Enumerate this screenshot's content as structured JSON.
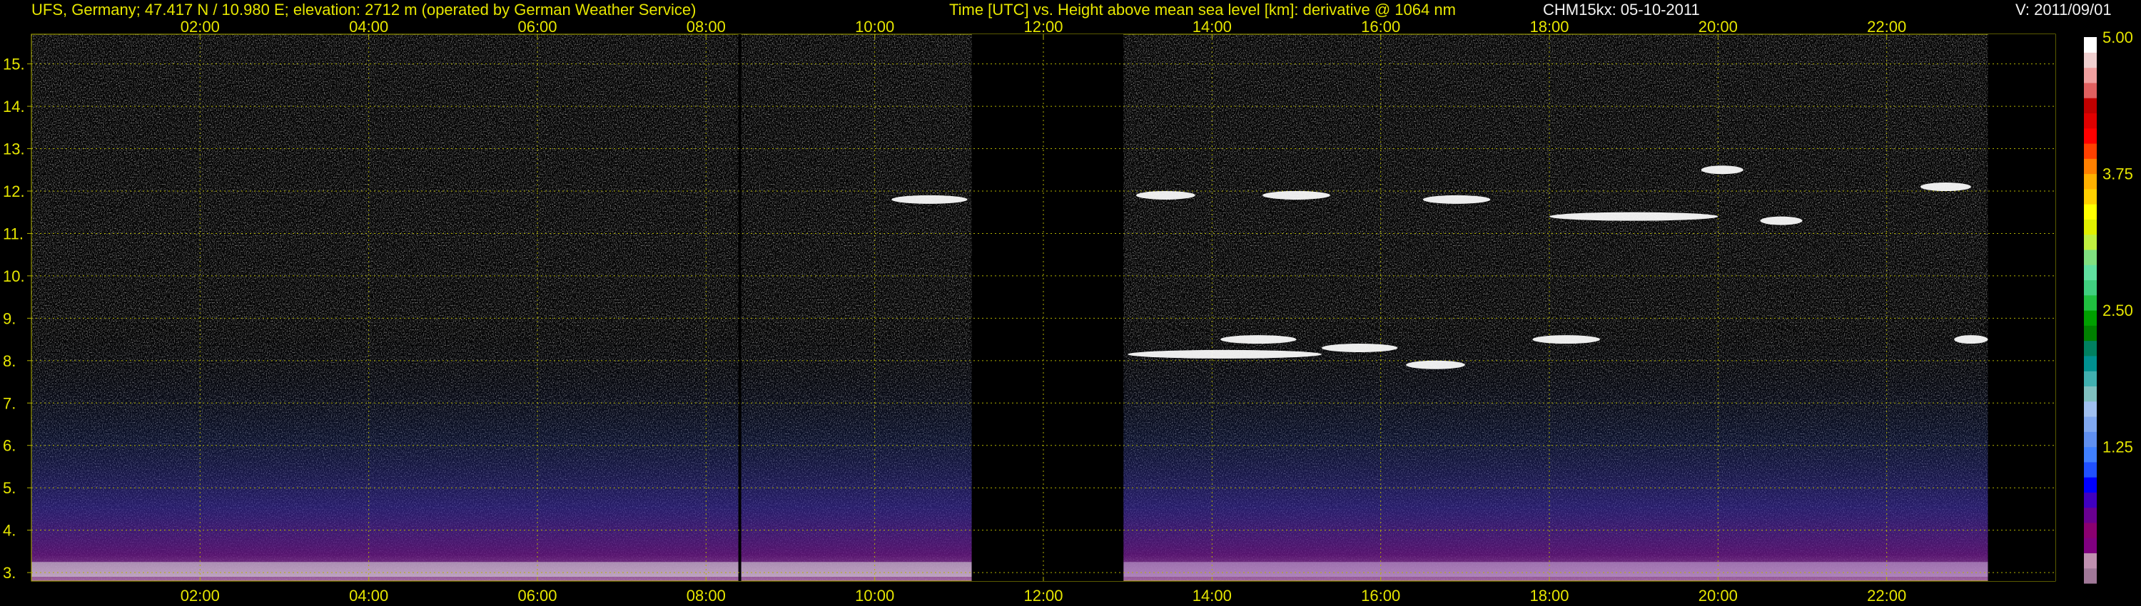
{
  "header": {
    "station": "UFS, Germany; 47.417 N / 10.980 E; elevation: 2712 m  (operated by German Weather Service)",
    "axes_desc": "Time [UTC] vs. Height above mean sea level [km]: derivative @ 1064 nm",
    "instrument": "CHM15kx: 05-10-2011",
    "version": "V: 2011/09/01"
  },
  "colors": {
    "text": "#e6e600",
    "grid": "#b3b300",
    "background": "#000000",
    "header_white": "#f2f2f2"
  },
  "chart_data": {
    "type": "heatmap",
    "title": "Time [UTC] vs. Height above mean sea level [km]: derivative @ 1064 nm",
    "xlabel": "Time [UTC]",
    "ylabel": "Height above mean sea level [km]",
    "x_range_hours": [
      0,
      24
    ],
    "y_range_km": [
      2.8,
      15.7
    ],
    "x_ticks": [
      "02:00",
      "04:00",
      "06:00",
      "08:00",
      "10:00",
      "12:00",
      "14:00",
      "16:00",
      "18:00",
      "20:00",
      "22:00"
    ],
    "x_tick_hours": [
      2,
      4,
      6,
      8,
      10,
      12,
      14,
      16,
      18,
      20,
      22
    ],
    "y_ticks": [
      "3.",
      "4.",
      "5.",
      "6.",
      "7.",
      "8.",
      "9.",
      "10.",
      "11.",
      "12.",
      "13.",
      "14.",
      "15."
    ],
    "y_tick_values": [
      3,
      4,
      5,
      6,
      7,
      8,
      9,
      10,
      11,
      12,
      13,
      14,
      15
    ],
    "grid": true,
    "colorbar": {
      "min": 0,
      "max": 5,
      "tick_labels": [
        "5.00",
        "3.75",
        "2.50",
        "1.25"
      ],
      "tick_values": [
        5.0,
        3.75,
        2.5,
        1.25
      ],
      "palette": [
        "#a07898",
        "#c090b0",
        "#800080",
        "#8a0070",
        "#6a0090",
        "#4000c0",
        "#0000ff",
        "#2050ff",
        "#4080ff",
        "#6090f0",
        "#80a8f0",
        "#a0c0f0",
        "#80c0c0",
        "#40b0b0",
        "#009090",
        "#008060",
        "#008000",
        "#00a000",
        "#20c040",
        "#40d080",
        "#60e0a0",
        "#80e080",
        "#c0f040",
        "#e0f000",
        "#ffff00",
        "#ffd000",
        "#ffb000",
        "#ff8000",
        "#ff4000",
        "#ff0000",
        "#e00000",
        "#c00000",
        "#e06060",
        "#f0a0a0",
        "#f0d0d0",
        "#ffffff"
      ],
      "position": "right"
    },
    "data_gaps_hours": [
      [
        11.15,
        12.95
      ],
      [
        23.2,
        24.0
      ]
    ],
    "instrument_gap_line_hour": 8.4,
    "cloud_layers": [
      {
        "start_hour": 13.0,
        "end_hour": 15.3,
        "height_km": 8.15
      },
      {
        "start_hour": 14.1,
        "end_hour": 15.0,
        "height_km": 8.5
      },
      {
        "start_hour": 15.3,
        "end_hour": 16.2,
        "height_km": 8.3
      },
      {
        "start_hour": 16.3,
        "end_hour": 17.0,
        "height_km": 7.9
      },
      {
        "start_hour": 17.8,
        "end_hour": 18.6,
        "height_km": 8.5
      },
      {
        "start_hour": 22.8,
        "end_hour": 23.2,
        "height_km": 8.5
      },
      {
        "start_hour": 22.4,
        "end_hour": 23.0,
        "height_km": 12.1
      },
      {
        "start_hour": 19.8,
        "end_hour": 20.3,
        "height_km": 12.5
      },
      {
        "start_hour": 18.0,
        "end_hour": 20.0,
        "height_km": 11.4
      },
      {
        "start_hour": 20.5,
        "end_hour": 21.0,
        "height_km": 11.3
      },
      {
        "start_hour": 16.5,
        "end_hour": 17.3,
        "height_km": 11.8
      },
      {
        "start_hour": 13.1,
        "end_hour": 13.8,
        "height_km": 11.9
      },
      {
        "start_hour": 14.6,
        "end_hour": 15.4,
        "height_km": 11.9
      },
      {
        "start_hour": 10.2,
        "end_hour": 11.1,
        "height_km": 11.8
      }
    ]
  }
}
